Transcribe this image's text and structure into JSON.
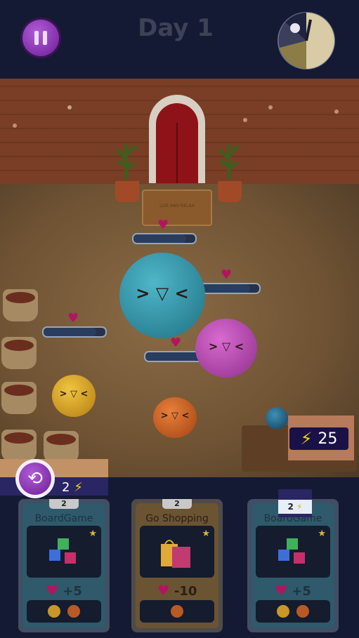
{
  "header": {
    "day_title": "Day 1",
    "pause_icon": "pause-icon",
    "clock_icon": "day-clock-icon"
  },
  "scene": {
    "doormat_text": "LIVE AND RELAX",
    "meters": [
      {
        "id": "blue-pet",
        "fill_fraction": 0.85
      },
      {
        "id": "pink-pet",
        "fill_fraction": 0.85
      },
      {
        "id": "yellow-pet",
        "fill_fraction": 0.85
      },
      {
        "id": "orange-pet",
        "fill_fraction": 0.85
      }
    ],
    "pet_face": "> ▽ <"
  },
  "energy": {
    "value": "25",
    "icon": "lightning-icon"
  },
  "reroll": {
    "icon": "reroll-icon",
    "cost": "2"
  },
  "cards": [
    {
      "cost": "2",
      "title": "BoardGame",
      "effect": "+5",
      "art_icon": "abc-blocks-icon",
      "pets": [
        "yellow-pet-icon",
        "orange-pet-icon"
      ]
    },
    {
      "cost": "2",
      "title": "Go Shopping",
      "effect": "-10",
      "art_icon": "shopping-bags-icon",
      "pets": [
        "orange-pet-icon"
      ]
    },
    {
      "cost": "2",
      "title": "BoardGame",
      "effect": "+5",
      "art_icon": "abc-blocks-icon",
      "pets": [
        "yellow-pet-icon",
        "orange-pet-icon"
      ]
    }
  ],
  "colors": {
    "heart": "#b21560",
    "energy_bolt": "#f3d21b",
    "accent_purple": "#8e35b8"
  }
}
